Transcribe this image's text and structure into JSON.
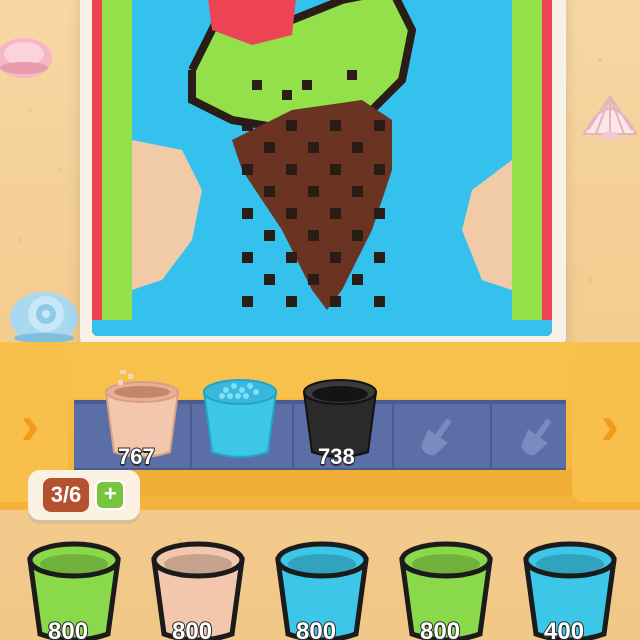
{
  "artwork": {
    "palette": {
      "water": "#35c1ee",
      "leaf": "#93e04a",
      "dark": "#2a1c16",
      "cone": "#6b3422",
      "cherry": "#ec4455",
      "sand": "#f1caa7",
      "edge": "#e8e0d2"
    }
  },
  "conveyor": {
    "buckets": [
      {
        "name": "peach-bucket",
        "color": "#f3c7ad",
        "count": "767",
        "state": "pouring"
      },
      {
        "name": "blue-bucket",
        "color": "#3cc7e8",
        "count": "",
        "state": "full"
      },
      {
        "name": "black-bucket",
        "color": "#2a2a2a",
        "count": "738",
        "state": "empty"
      }
    ],
    "empty_slot_icons": [
      "shovel-icon",
      "shovel-icon"
    ]
  },
  "slot_counter": {
    "value": "3/6",
    "plus": "+"
  },
  "queue": [
    {
      "color": "#8ad94a",
      "count": "800"
    },
    {
      "color": "#f3c7ad",
      "count": "800"
    },
    {
      "color": "#3cc7e8",
      "count": "800"
    },
    {
      "color": "#8ad94a",
      "count": "800"
    },
    {
      "color": "#3cc7e8",
      "count": "400"
    }
  ],
  "arrows": {
    "left": "›",
    "right": "›"
  }
}
